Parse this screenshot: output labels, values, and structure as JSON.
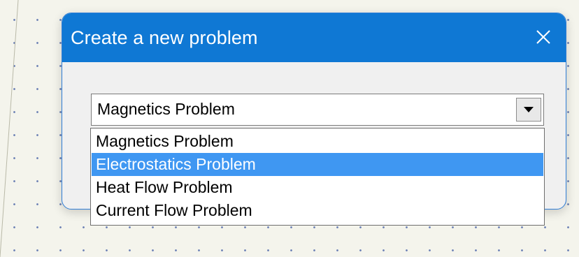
{
  "dialog": {
    "title": "Create a new problem",
    "close_icon": "close-icon"
  },
  "problem_type_select": {
    "selected_value": "Magnetics Problem",
    "dropdown_icon": "dropdown-arrow-icon",
    "expanded": true,
    "options": [
      {
        "label": "Magnetics Problem",
        "highlighted": false
      },
      {
        "label": "Electrostatics Problem",
        "highlighted": true
      },
      {
        "label": "Heat Flow Problem",
        "highlighted": false
      },
      {
        "label": "Current Flow Problem",
        "highlighted": false
      }
    ]
  },
  "colors": {
    "titlebar": "#0f78d4",
    "highlight": "#3f97f2",
    "dialog_background": "#f0f0f0",
    "page_background": "#f4f4ec",
    "dot_pattern": "#6a7fb4"
  }
}
